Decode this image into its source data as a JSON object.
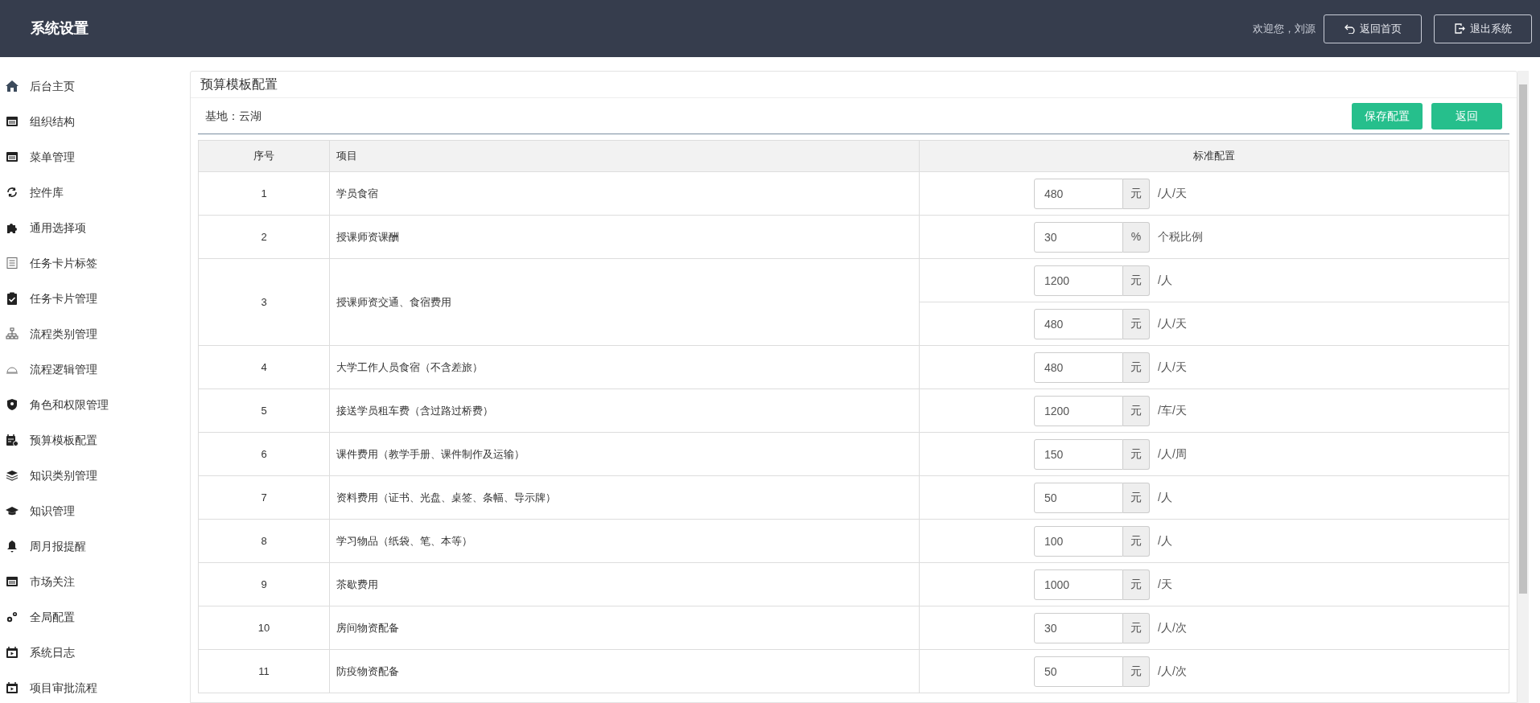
{
  "header": {
    "title": "系统设置",
    "greeting": "欢迎您，刘源",
    "buttons": [
      {
        "label": "返回首页",
        "kind": "home"
      },
      {
        "label": "退出系统",
        "kind": "logout"
      }
    ]
  },
  "sidebar": {
    "items": [
      {
        "label": "后台主页"
      },
      {
        "label": "组织结构"
      },
      {
        "label": "菜单管理"
      },
      {
        "label": "控件库"
      },
      {
        "label": "通用选择项"
      },
      {
        "label": "任务卡片标签"
      },
      {
        "label": "任务卡片管理"
      },
      {
        "label": "流程类别管理"
      },
      {
        "label": "流程逻辑管理"
      },
      {
        "label": "角色和权限管理"
      },
      {
        "label": "预算模板配置"
      },
      {
        "label": "知识类别管理"
      },
      {
        "label": "知识管理"
      },
      {
        "label": "周月报提醒"
      },
      {
        "label": "市场关注"
      },
      {
        "label": "全局配置"
      },
      {
        "label": "系统日志"
      },
      {
        "label": "项目审批流程"
      }
    ]
  },
  "panel": {
    "title": "预算模板配置",
    "base": "基地：云湖",
    "buttons": [
      "保存配置",
      "返回"
    ],
    "table": {
      "columns": [
        "序号",
        "项目",
        "标准配置"
      ],
      "rows": [
        {
          "index": "1",
          "item": "学员食宿",
          "configs": [
            {
              "value": "480",
              "addon": "元",
              "suffix": "/人/天"
            }
          ]
        },
        {
          "index": "2",
          "item": "授课师资课酬",
          "configs": [
            {
              "value": "30",
              "addon": "%",
              "suffix": "个税比例"
            }
          ]
        },
        {
          "index": "3",
          "item": "授课师资交通、食宿费用",
          "configs": [
            {
              "value": "1200",
              "addon": "元",
              "suffix": "/人"
            },
            {
              "value": "480",
              "addon": "元",
              "suffix": "/人/天"
            }
          ]
        },
        {
          "index": "4",
          "item": "大学工作人员食宿（不含差旅）",
          "configs": [
            {
              "value": "480",
              "addon": "元",
              "suffix": "/人/天"
            }
          ]
        },
        {
          "index": "5",
          "item": "接送学员租车费（含过路过桥费）",
          "configs": [
            {
              "value": "1200",
              "addon": "元",
              "suffix": "/车/天"
            }
          ]
        },
        {
          "index": "6",
          "item": "课件费用（教学手册、课件制作及运输）",
          "configs": [
            {
              "value": "150",
              "addon": "元",
              "suffix": "/人/周"
            }
          ]
        },
        {
          "index": "7",
          "item": "资料费用（证书、光盘、桌签、条幅、导示牌）",
          "configs": [
            {
              "value": "50",
              "addon": "元",
              "suffix": "/人"
            }
          ]
        },
        {
          "index": "8",
          "item": "学习物品（纸袋、笔、本等）",
          "configs": [
            {
              "value": "100",
              "addon": "元",
              "suffix": "/人"
            }
          ]
        },
        {
          "index": "9",
          "item": "茶歇费用",
          "configs": [
            {
              "value": "1000",
              "addon": "元",
              "suffix": "/天"
            }
          ]
        },
        {
          "index": "10",
          "item": "房间物资配备",
          "configs": [
            {
              "value": "30",
              "addon": "元",
              "suffix": "/人/次"
            }
          ]
        },
        {
          "index": "11",
          "item": "防疫物资配备",
          "configs": [
            {
              "value": "50",
              "addon": "元",
              "suffix": "/人/次"
            }
          ]
        }
      ]
    }
  }
}
